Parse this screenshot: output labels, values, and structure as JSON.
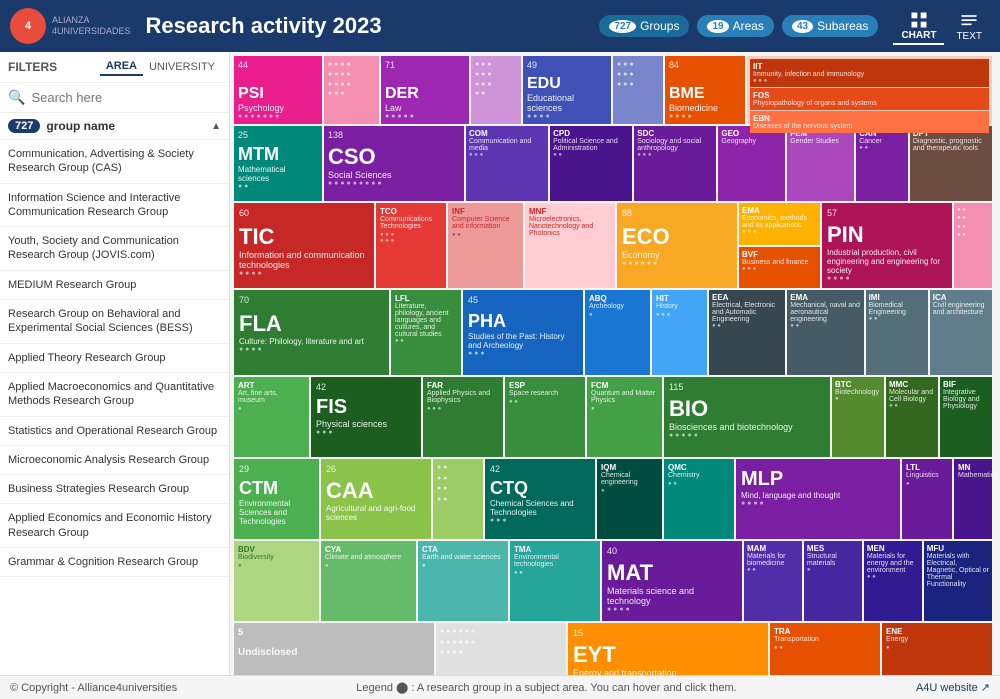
{
  "header": {
    "title": "Research activity 2023",
    "logo_text": "ALIANZA\n4UNIVERSIDADES",
    "groups_label": "Groups",
    "groups_count": "727",
    "areas_label": "Areas",
    "areas_count": "19",
    "subareas_label": "Subareas",
    "subareas_count": "43",
    "chart_label": "CHART",
    "text_label": "TEXT"
  },
  "sidebar": {
    "filters_label": "FILTERS",
    "area_tab": "AREA",
    "university_tab": "UNIVERSITY",
    "search_placeholder": "Search here",
    "group_count": "727",
    "group_label": "group name",
    "items": [
      "Communication, Advertising & Society Research Group (CAS)",
      "Information Science and Interactive Communication Research Group",
      "Youth, Society and Communication Research Group (JOVIS.com)",
      "MEDIUM Research Group",
      "Research Group on Behavioral and Experimental Social Sciences (BESS)",
      "Applied Theory Research Group",
      "Applied Macroeconomics and Quantitative Methods Research Group",
      "Statistics and Operational Research Group",
      "Microeconomic Analysis Research Group",
      "Business Strategies Research Group",
      "Applied Economics and Economic History Research Group",
      "Grammar & Cognition Research Group"
    ]
  },
  "footer": {
    "copyright": "© Copyright - Alliance4universities",
    "legend": "Legend  ⬤ : A research group in a subject area. You can hover and click them.",
    "link": "A4U website ↗"
  },
  "cells": {
    "PSI": {
      "code": "PSI",
      "name": "Psychology",
      "num": "44",
      "color": "#e91e8c"
    },
    "DER": {
      "code": "DER",
      "name": "Law",
      "num": "71",
      "color": "#9c27b0"
    },
    "EDU": {
      "code": "EDU",
      "name": "Educational sciences",
      "num": "49",
      "color": "#3f51b5"
    },
    "BME": {
      "code": "BME",
      "name": "Biomedicine",
      "num": "84",
      "color": "#e65100"
    },
    "MTM": {
      "code": "MTM",
      "name": "Mathematical sciences",
      "num": "25",
      "color": "#00897b"
    },
    "CSO": {
      "code": "CSO",
      "name": "Social Sciences",
      "num": "138",
      "color": "#7b1fa2"
    },
    "TIC": {
      "code": "TIC",
      "name": "Information and communication technologies",
      "num": "60",
      "color": "#c62828"
    },
    "ECO": {
      "code": "ECO",
      "name": "Economy",
      "num": "88",
      "color": "#f9a825"
    },
    "PIN": {
      "code": "PIN",
      "name": "Industrial production, civil engineering and engineering for society",
      "num": "57",
      "color": "#ad1457"
    },
    "FLA": {
      "code": "FLA",
      "name": "Culture: Philology, literature and art",
      "num": "70",
      "color": "#2e7d32"
    },
    "PHA": {
      "code": "PHA",
      "name": "Studies of the Past: History and Archeology",
      "num": "45",
      "color": "#1565c0"
    },
    "BIO": {
      "code": "BIO",
      "name": "Biosciences and biotechnology",
      "num": "115",
      "color": "#2e7d32"
    },
    "FIS": {
      "code": "FIS",
      "name": "Physical sciences",
      "num": "42",
      "color": "#1b5e20"
    },
    "CTM": {
      "code": "CTM",
      "name": "Environmental Sciences and Technologies",
      "num": "29",
      "color": "#4caf50"
    },
    "CAA": {
      "code": "CAA",
      "name": "Agricultural and agri-food sciences",
      "num": "26",
      "color": "#8bc34a"
    },
    "CTQ": {
      "code": "CTQ",
      "name": "Chemical Sciences and Technologies",
      "num": "42",
      "color": "#00695c"
    },
    "MLP": {
      "code": "MLP",
      "name": "Mind, language and thought",
      "num": "",
      "color": "#7b1fa2"
    },
    "MAT": {
      "code": "MAT",
      "name": "Materials science and technology",
      "num": "40",
      "color": "#6a1b9a"
    },
    "EYT": {
      "code": "EYT",
      "name": "Energy and transportation",
      "num": "15",
      "color": "#ff8f00"
    }
  }
}
